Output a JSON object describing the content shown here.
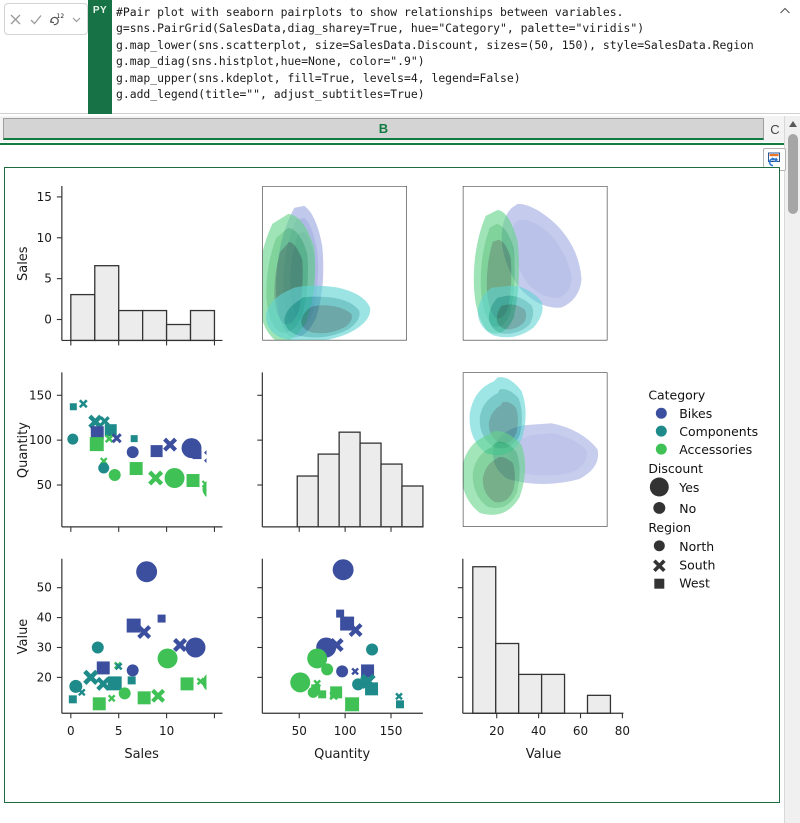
{
  "formula_bar": {
    "cancel_icon": "cancel-x-icon",
    "enter_icon": "check-icon",
    "refresh_icon": "refresh-123-icon",
    "dropdown_icon": "chevron-down-icon",
    "language_badge": "PY",
    "collapse_icon": "chevron-up-icon",
    "code": "#Pair plot with seaborn pairplots to show relationships between variables.\ng=sns.PairGrid(SalesData,diag_sharey=True, hue=\"Category\", palette=\"viridis\")\ng.map_lower(sns.scatterplot, size=SalesData.Discount, sizes=(50, 150), style=SalesData.Region\ng.map_diag(sns.histplot,hue=None, color=\".9\")\ng.map_upper(sns.kdeplot, fill=True, levels=4, legend=False)\ng.add_legend(title=\"\", adjust_subtitles=True)"
  },
  "grid": {
    "selected_column": "B",
    "next_column": "C",
    "image_in_cell_icon": "picture-in-cell-icon",
    "scroll_up_icon": "triangle-up-icon",
    "scroll_down_icon": "triangle-down-icon"
  },
  "colors": {
    "bikes": "#3b4f9e",
    "components": "#1e8a8a",
    "accessories": "#3fc155",
    "hist_fill": "#ececec",
    "hist_edge": "#333333",
    "excel_green": "#107c41",
    "card_border": "#1d6b3f"
  },
  "chart_data": {
    "type": "scatter",
    "title": "",
    "plot_kind": "seaborn PairGrid pairplot",
    "variables": [
      "Sales",
      "Quantity",
      "Value"
    ],
    "hue": "Category",
    "size": "Discount",
    "style": "Region",
    "axes": {
      "Sales": {
        "ticks": [
          0,
          5,
          10
        ],
        "lim": [
          -1.2,
          12.0
        ]
      },
      "Quantity": {
        "ticks": [
          50,
          100,
          150
        ],
        "lim": [
          25,
          175
        ]
      },
      "Value": {
        "ticks": [
          20,
          30,
          40,
          50
        ],
        "xticks": [
          20,
          40,
          60,
          80
        ],
        "lim": [
          8,
          62
        ],
        "xlim": [
          2,
          82
        ]
      }
    },
    "diagonal": {
      "type": "histogram",
      "panels": [
        {
          "var": "Sales",
          "ylabel": "Sales",
          "yticks": [
            0,
            5,
            10,
            15
          ],
          "bin_edges": [
            0.3,
            2.0,
            3.7,
            5.4,
            7.1,
            8.8,
            10.5
          ],
          "counts": [
            3.5,
            6.5,
            2.0,
            2.0,
            0.5,
            2.0
          ]
        },
        {
          "var": "Quantity",
          "ylabel": "Quantity",
          "bin_edges": [
            40,
            60,
            80,
            100,
            120,
            140,
            160
          ],
          "counts": [
            47,
            74,
            101,
            88,
            60,
            32
          ]
        },
        {
          "var": "Value",
          "ylabel": "Value",
          "bin_edges": [
            10,
            20,
            30,
            40,
            50,
            60,
            70
          ],
          "counts": [
            57,
            36,
            21,
            21,
            0,
            10
          ]
        }
      ]
    },
    "upper_triangle": {
      "type": "kdeplot",
      "fill": true,
      "levels": 4,
      "legend": false,
      "panels": [
        "Sales~Quantity",
        "Sales~Value",
        "Quantity~Value"
      ]
    },
    "lower_triangle": {
      "type": "scatterplot",
      "sizes": [
        50,
        150
      ],
      "panels": [
        "Quantity~Sales",
        "Value~Sales",
        "Value~Quantity"
      ],
      "points_quantity_vs_sales": [
        {
          "x": 0.6,
          "y": 141,
          "cat": "Components",
          "region": "West",
          "disc": "No"
        },
        {
          "x": 1.1,
          "y": 144,
          "cat": "Components",
          "region": "South",
          "disc": "No"
        },
        {
          "x": 1.7,
          "y": 122,
          "cat": "Components",
          "region": "South",
          "disc": "Yes"
        },
        {
          "x": 2.3,
          "y": 121,
          "cat": "Components",
          "region": "West",
          "disc": "No"
        },
        {
          "x": 2.0,
          "y": 112,
          "cat": "Bikes",
          "region": "West",
          "disc": "Yes"
        },
        {
          "x": 2.6,
          "y": 113,
          "cat": "Components",
          "region": "West",
          "disc": "Yes"
        },
        {
          "x": 0.5,
          "y": 101,
          "cat": "Components",
          "region": "North",
          "disc": "No"
        },
        {
          "x": 2.1,
          "y": 101,
          "cat": "Accessories",
          "region": "West",
          "disc": "Yes"
        },
        {
          "x": 3.0,
          "y": 101,
          "cat": "Bikes",
          "region": "South",
          "disc": "No"
        },
        {
          "x": 3.9,
          "y": 101,
          "cat": "Components",
          "region": "West",
          "disc": "No"
        },
        {
          "x": 4.4,
          "y": 92,
          "cat": "Bikes",
          "region": "North",
          "disc": "No"
        },
        {
          "x": 5.4,
          "y": 93,
          "cat": "Bikes",
          "region": "West",
          "disc": "Yes"
        },
        {
          "x": 6.2,
          "y": 95,
          "cat": "Bikes",
          "region": "South",
          "disc": "Yes"
        },
        {
          "x": 7.8,
          "y": 88,
          "cat": "Bikes",
          "region": "North",
          "disc": "Yes"
        },
        {
          "x": 8.3,
          "y": 85,
          "cat": "Bikes",
          "region": "West",
          "disc": "No"
        },
        {
          "x": 9.4,
          "y": 82,
          "cat": "Bikes",
          "region": "South",
          "disc": "Yes"
        },
        {
          "x": 10.4,
          "y": 76,
          "cat": "Bikes",
          "region": "North",
          "disc": "Yes"
        },
        {
          "x": 3.2,
          "y": 79,
          "cat": "Accessories",
          "region": "South",
          "disc": "No"
        },
        {
          "x": 3.3,
          "y": 75,
          "cat": "Components",
          "region": "North",
          "disc": "No"
        },
        {
          "x": 4.1,
          "y": 71,
          "cat": "Accessories",
          "region": "North",
          "disc": "No"
        },
        {
          "x": 5.1,
          "y": 79,
          "cat": "Accessories",
          "region": "West",
          "disc": "Yes"
        },
        {
          "x": 6.0,
          "y": 68,
          "cat": "Accessories",
          "region": "South",
          "disc": "Yes"
        },
        {
          "x": 6.9,
          "y": 68,
          "cat": "Accessories",
          "region": "North",
          "disc": "Yes"
        },
        {
          "x": 7.8,
          "y": 64,
          "cat": "Accessories",
          "region": "West",
          "disc": "No"
        },
        {
          "x": 8.8,
          "y": 62,
          "cat": "Accessories",
          "region": "South",
          "disc": "No"
        },
        {
          "x": 9.9,
          "y": 56,
          "cat": "Accessories",
          "region": "North",
          "disc": "Yes"
        }
      ],
      "points_value_vs_sales": [
        {
          "x": 7.8,
          "y": 57,
          "cat": "Bikes",
          "region": "North",
          "disc": "Yes"
        },
        {
          "x": 8.4,
          "y": 41,
          "cat": "Bikes",
          "region": "West",
          "disc": "No"
        },
        {
          "x": 5.6,
          "y": 39,
          "cat": "Bikes",
          "region": "West",
          "disc": "No"
        },
        {
          "x": 6.6,
          "y": 37,
          "cat": "Bikes",
          "region": "South",
          "disc": "No"
        },
        {
          "x": 9.5,
          "y": 31,
          "cat": "Bikes",
          "region": "South",
          "disc": "Yes"
        },
        {
          "x": 10.5,
          "y": 31,
          "cat": "Bikes",
          "region": "North",
          "disc": "Yes"
        },
        {
          "x": 2.6,
          "y": 31,
          "cat": "Components",
          "region": "North",
          "disc": "No"
        },
        {
          "x": 7.8,
          "y": 27,
          "cat": "Accessories",
          "region": "North",
          "disc": "Yes"
        },
        {
          "x": 2.5,
          "y": 24,
          "cat": "Bikes",
          "region": "West",
          "disc": "No"
        },
        {
          "x": 3.5,
          "y": 24,
          "cat": "Components",
          "region": "South",
          "disc": "No"
        },
        {
          "x": 4.4,
          "y": 23,
          "cat": "Bikes",
          "region": "North",
          "disc": "No"
        },
        {
          "x": 1.9,
          "y": 21,
          "cat": "Components",
          "region": "South",
          "disc": "Yes"
        },
        {
          "x": 2.9,
          "y": 20,
          "cat": "Components",
          "region": "South",
          "disc": "Yes"
        },
        {
          "x": 3.4,
          "y": 20,
          "cat": "Components",
          "region": "West",
          "disc": "Yes"
        },
        {
          "x": 4.0,
          "y": 21,
          "cat": "Components",
          "region": "West",
          "disc": "No"
        },
        {
          "x": 8.9,
          "y": 20,
          "cat": "Accessories",
          "region": "West",
          "disc": "No"
        },
        {
          "x": 9.7,
          "y": 20,
          "cat": "Accessories",
          "region": "South",
          "disc": "No"
        },
        {
          "x": 10.4,
          "y": 20,
          "cat": "Accessories",
          "region": "North",
          "disc": "Yes"
        },
        {
          "x": 0.8,
          "y": 17,
          "cat": "Components",
          "region": "North",
          "disc": "No"
        },
        {
          "x": 1.2,
          "y": 15,
          "cat": "Components",
          "region": "South",
          "disc": "No"
        },
        {
          "x": 0.6,
          "y": 14,
          "cat": "Components",
          "region": "West",
          "disc": "No"
        },
        {
          "x": 2.3,
          "y": 13,
          "cat": "Accessories",
          "region": "West",
          "disc": "No"
        },
        {
          "x": 3.2,
          "y": 14,
          "cat": "Accessories",
          "region": "South",
          "disc": "No"
        },
        {
          "x": 4.2,
          "y": 15,
          "cat": "Accessories",
          "region": "North",
          "disc": "No"
        },
        {
          "x": 5.2,
          "y": 15,
          "cat": "Accessories",
          "region": "West",
          "disc": "No"
        },
        {
          "x": 6.1,
          "y": 15,
          "cat": "Accessories",
          "region": "South",
          "disc": "Yes"
        }
      ],
      "points_value_vs_quantity": [
        {
          "x": 76,
          "y": 57,
          "cat": "Bikes",
          "region": "North",
          "disc": "Yes"
        },
        {
          "x": 74,
          "y": 41,
          "cat": "Bikes",
          "region": "West",
          "disc": "No"
        },
        {
          "x": 78,
          "y": 38,
          "cat": "Bikes",
          "region": "West",
          "disc": "No"
        },
        {
          "x": 85,
          "y": 36,
          "cat": "Bikes",
          "region": "South",
          "disc": "No"
        },
        {
          "x": 66,
          "y": 31,
          "cat": "Bikes",
          "region": "North",
          "disc": "Yes"
        },
        {
          "x": 73,
          "y": 31,
          "cat": "Bikes",
          "region": "South",
          "disc": "Yes"
        },
        {
          "x": 100,
          "y": 29,
          "cat": "Components",
          "region": "North",
          "disc": "No"
        },
        {
          "x": 62,
          "y": 27,
          "cat": "Accessories",
          "region": "North",
          "disc": "Yes"
        },
        {
          "x": 72,
          "y": 24,
          "cat": "Components",
          "region": "North",
          "disc": "No"
        },
        {
          "x": 76,
          "y": 23,
          "cat": "Bikes",
          "region": "North",
          "disc": "No"
        },
        {
          "x": 88,
          "y": 23,
          "cat": "Bikes",
          "region": "South",
          "disc": "No"
        },
        {
          "x": 92,
          "y": 24,
          "cat": "Bikes",
          "region": "West",
          "disc": "No"
        },
        {
          "x": 96,
          "y": 21,
          "cat": "Components",
          "region": "West",
          "disc": "No"
        },
        {
          "x": 100,
          "y": 21,
          "cat": "Components",
          "region": "South",
          "disc": "Yes"
        },
        {
          "x": 92,
          "y": 20,
          "cat": "Components",
          "region": "West",
          "disc": "Yes"
        },
        {
          "x": 90,
          "y": 18,
          "cat": "Components",
          "region": "North",
          "disc": "No"
        },
        {
          "x": 95,
          "y": 18,
          "cat": "Components",
          "region": "West",
          "disc": "No"
        },
        {
          "x": 55,
          "y": 20,
          "cat": "Accessories",
          "region": "North",
          "disc": "Yes"
        },
        {
          "x": 60,
          "y": 18,
          "cat": "Accessories",
          "region": "West",
          "disc": "No"
        },
        {
          "x": 63,
          "y": 17,
          "cat": "Accessories",
          "region": "South",
          "disc": "No"
        },
        {
          "x": 58,
          "y": 15,
          "cat": "Accessories",
          "region": "North",
          "disc": "No"
        },
        {
          "x": 66,
          "y": 15,
          "cat": "Accessories",
          "region": "West",
          "disc": "No"
        },
        {
          "x": 70,
          "y": 15,
          "cat": "Accessories",
          "region": "South",
          "disc": "No"
        },
        {
          "x": 80,
          "y": 13,
          "cat": "Accessories",
          "region": "West",
          "disc": "Yes"
        },
        {
          "x": 120,
          "y": 15,
          "cat": "Components",
          "region": "South",
          "disc": "No"
        },
        {
          "x": 121,
          "y": 14,
          "cat": "Components",
          "region": "West",
          "disc": "No"
        }
      ]
    },
    "legend": {
      "position": "right",
      "groups": [
        {
          "title": "Category",
          "marker": "circle",
          "entries": [
            {
              "label": "Bikes",
              "color": "#3b4f9e",
              "size": 7
            },
            {
              "label": "Components",
              "color": "#1e8a8a",
              "size": 7
            },
            {
              "label": "Accessories",
              "color": "#3fc155",
              "size": 7
            }
          ]
        },
        {
          "title": "Discount",
          "marker": "circle",
          "entries": [
            {
              "label": "Yes",
              "color": "#333333",
              "size": 11
            },
            {
              "label": "No",
              "color": "#333333",
              "size": 7
            }
          ]
        },
        {
          "title": "Region",
          "entries": [
            {
              "label": "North",
              "color": "#333333",
              "marker": "circle",
              "size": 7
            },
            {
              "label": "South",
              "color": "#333333",
              "marker": "x",
              "size": 8
            },
            {
              "label": "West",
              "color": "#333333",
              "marker": "square",
              "size": 6
            }
          ]
        }
      ]
    }
  }
}
